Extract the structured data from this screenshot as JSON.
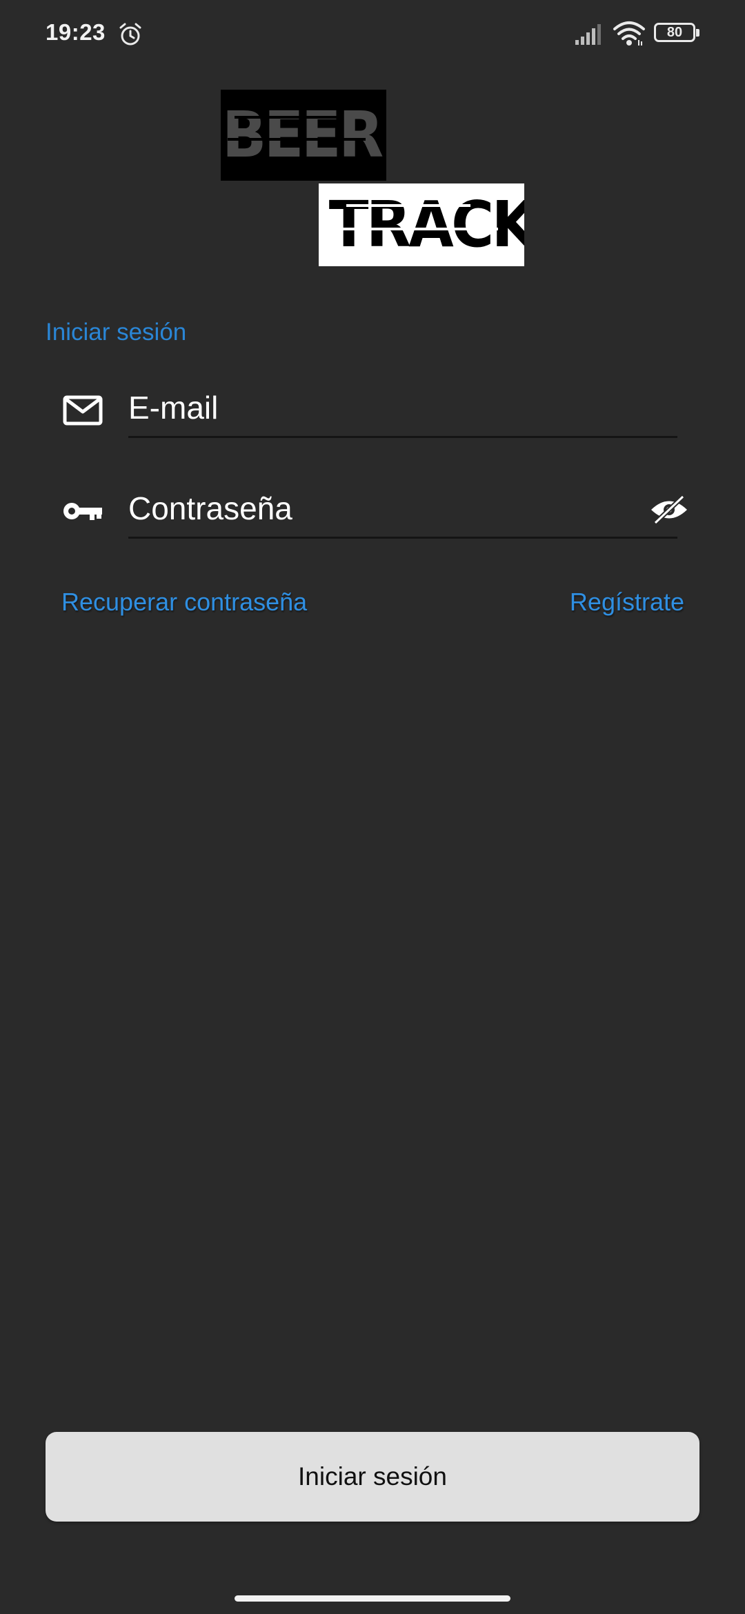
{
  "status_bar": {
    "time": "19:23",
    "battery_level": "80",
    "icons": [
      "alarm-icon",
      "signal-icon",
      "wifi-icon",
      "battery-icon"
    ]
  },
  "logo": {
    "line1": "BEER",
    "line2": "TRACK"
  },
  "login": {
    "section_title": "Iniciar sesión",
    "email_placeholder": "E-mail",
    "password_placeholder": "Contraseña",
    "recover_link": "Recuperar contraseña",
    "register_link": "Regístrate",
    "submit_label": "Iniciar sesión"
  },
  "colors": {
    "background": "#2a2a2a",
    "accent": "#2f8fe2",
    "button": "#e0e0e0"
  }
}
